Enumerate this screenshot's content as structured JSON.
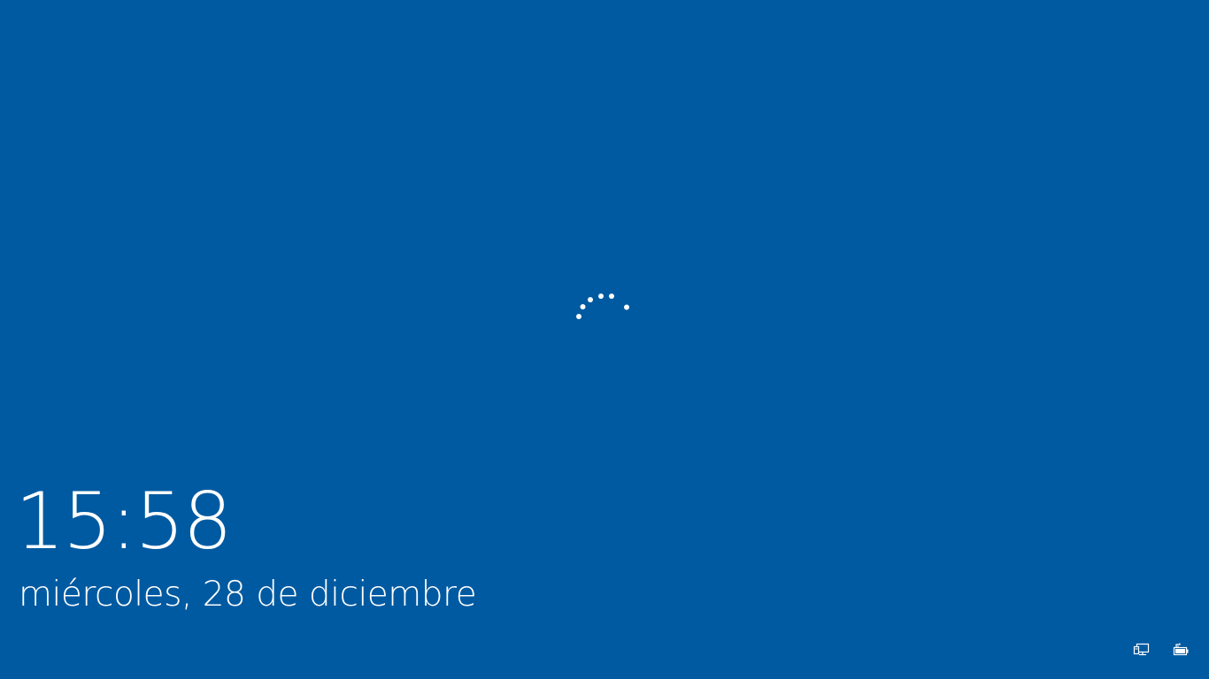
{
  "lock_screen": {
    "time": "15:58",
    "date": "miércoles, 28 de diciembre"
  },
  "loading": {
    "icon": "loading-spinner-icon",
    "dot_color": "#ffffff"
  },
  "tray": {
    "network_icon": "network-icon",
    "battery_icon": "battery-icon"
  },
  "colors": {
    "background": "#005aa1",
    "foreground": "#ffffff"
  }
}
